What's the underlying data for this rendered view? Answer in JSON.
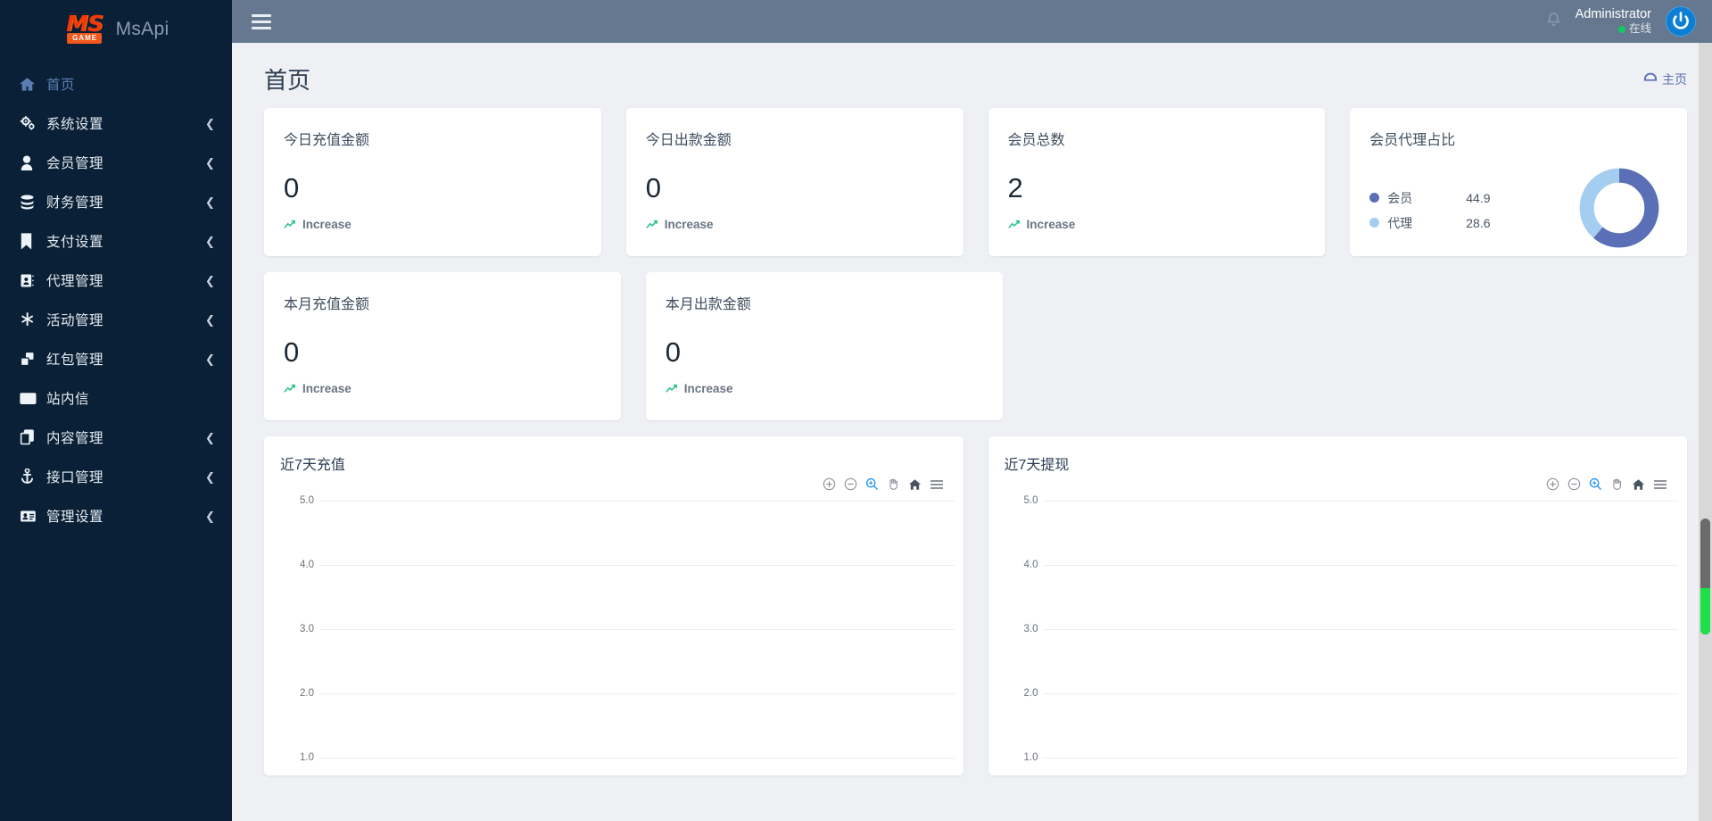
{
  "sidebar": {
    "brand": {
      "logo_ms": "MS",
      "logo_tag": "GAME",
      "name": "MsApi"
    },
    "items": [
      {
        "label": "首页",
        "icon": "home-icon",
        "arrow": "",
        "active": true
      },
      {
        "label": "系统设置",
        "icon": "gears-icon",
        "arrow": "❮",
        "active": false
      },
      {
        "label": "会员管理",
        "icon": "user-icon",
        "arrow": "❮",
        "active": false
      },
      {
        "label": "财务管理",
        "icon": "database-icon",
        "arrow": "❮",
        "active": false
      },
      {
        "label": "支付设置",
        "icon": "bookmark-icon",
        "arrow": "❮",
        "active": false
      },
      {
        "label": "代理管理",
        "icon": "id-card-icon",
        "arrow": "❮",
        "active": false
      },
      {
        "label": "活动管理",
        "icon": "asterisk-icon",
        "arrow": "❮",
        "active": false
      },
      {
        "label": "红包管理",
        "icon": "clone-squares-icon",
        "arrow": "❮",
        "active": false
      },
      {
        "label": "站内信",
        "icon": "envelope-icon",
        "arrow": "",
        "active": false
      },
      {
        "label": "内容管理",
        "icon": "copy-icon",
        "arrow": "❮",
        "active": false
      },
      {
        "label": "接口管理",
        "icon": "anchor-icon",
        "arrow": "❮",
        "active": false
      },
      {
        "label": "管理设置",
        "icon": "address-card-icon",
        "arrow": "❮",
        "active": false
      }
    ]
  },
  "topbar": {
    "menu_toggle": "hamburger-icon",
    "notification": "bell-icon",
    "user_name": "Administrator",
    "user_status": "在线",
    "avatar": "power-logo-icon"
  },
  "page": {
    "title": "首页",
    "breadcrumb": {
      "icon": "dashboard-icon",
      "label": "主页"
    }
  },
  "stat_cards": [
    {
      "title": "今日充值金额",
      "value": "0",
      "foot": "Increase",
      "trend": "trend-up-icon"
    },
    {
      "title": "今日出款金额",
      "value": "0",
      "foot": "Increase",
      "trend": "trend-up-icon"
    },
    {
      "title": "会员总数",
      "value": "2",
      "foot": "Increase",
      "trend": "trend-up-icon"
    },
    {
      "title": "本月充值金额",
      "value": "0",
      "foot": "Increase",
      "trend": "trend-up-icon"
    },
    {
      "title": "本月出款金额",
      "value": "0",
      "foot": "Increase",
      "trend": "trend-up-icon"
    }
  ],
  "toolbar_icons": {
    "zoom_in": "zoom-in-icon",
    "zoom_out": "zoom-out-icon",
    "selection_zoom": "selection-zoom-icon",
    "panning": "pan-hand-icon",
    "reset": "home-reset-icon",
    "menu": "chart-menu-icon"
  },
  "colors": {
    "sidebar_bg": "#0a2036",
    "topbar_bg": "#66788f",
    "page_bg": "#eef0f4",
    "accent_link": "#5a72b5",
    "donut_primary": "#5a6fb5",
    "donut_secondary": "#a5cdf0",
    "trend_green": "#27c281",
    "online_green": "#13c95f",
    "avatar_blue": "#0c7fd4"
  },
  "chart_data": [
    {
      "type": "pie",
      "variant": "donut",
      "title": "会员代理占比",
      "labels": [
        "会员",
        "代理"
      ],
      "values": [
        44.9,
        28.6
      ],
      "colors": [
        "#5a6fb5",
        "#a5cdf0"
      ],
      "legend": "left",
      "legend_entries": [
        {
          "label": "会员",
          "value": "44.9",
          "color": "#5a6fb5"
        },
        {
          "label": "代理",
          "value": "28.6",
          "color": "#a5cdf0"
        }
      ]
    },
    {
      "type": "line",
      "title": "近7天充值",
      "xlabel": "",
      "ylabel": "",
      "ylim": [
        1.0,
        5.0
      ],
      "yticks": [
        "5.0",
        "4.0",
        "3.0",
        "2.0",
        "1.0"
      ],
      "grid": true,
      "x": [],
      "series": [
        {
          "name": "近7天充值",
          "values": []
        }
      ]
    },
    {
      "type": "line",
      "title": "近7天提现",
      "xlabel": "",
      "ylabel": "",
      "ylim": [
        1.0,
        5.0
      ],
      "yticks": [
        "5.0",
        "4.0",
        "3.0",
        "2.0",
        "1.0"
      ],
      "grid": true,
      "x": [],
      "series": [
        {
          "name": "近7天提现",
          "values": []
        }
      ]
    }
  ]
}
